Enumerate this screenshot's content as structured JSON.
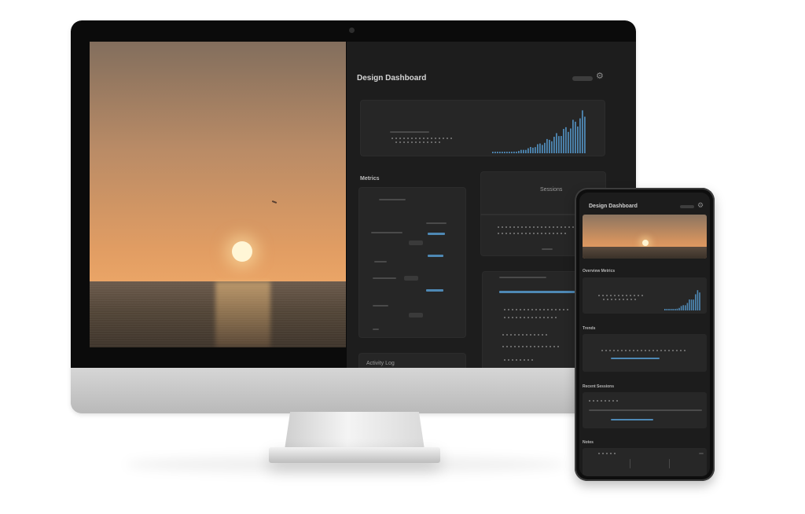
{
  "desktop": {
    "dashboard": {
      "title": "Design Dashboard",
      "settings_icon": "gear-icon",
      "section_label": "Metrics",
      "panel_b_label": "Sessions",
      "panel_c_label": "Activity Log"
    }
  },
  "phone": {
    "title": "Design Dashboard",
    "settings_icon": "gear-icon",
    "overview_label": "Overview Metrics",
    "section_1_label": "Trends",
    "section_2_label": "Recent Sessions",
    "section_3_label": "Notes"
  },
  "colors": {
    "accent": "#4e88b4",
    "dashboard_bg": "#1d1d1d",
    "card_bg": "#262626"
  }
}
